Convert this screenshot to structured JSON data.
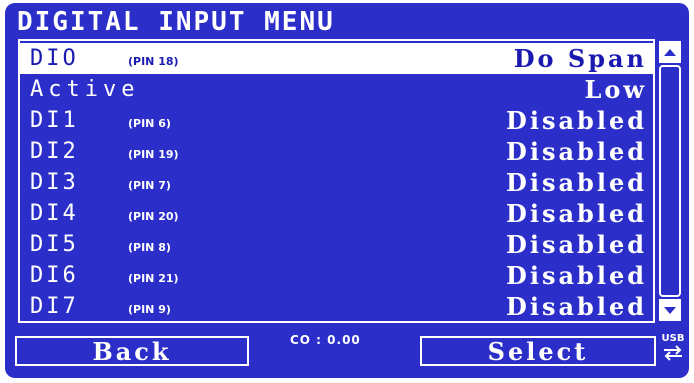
{
  "header": {
    "title": "DIGITAL INPUT MENU"
  },
  "rows": [
    {
      "name": "DIO",
      "pin": "(PIN 18)",
      "value": "Do Span",
      "selected": true
    },
    {
      "name": "Active",
      "pin": "",
      "value": "Low",
      "selected": false
    },
    {
      "name": "DI1",
      "pin": "(PIN 6)",
      "value": "Disabled",
      "selected": false
    },
    {
      "name": "DI2",
      "pin": "(PIN 19)",
      "value": "Disabled",
      "selected": false
    },
    {
      "name": "DI3",
      "pin": "(PIN 7)",
      "value": "Disabled",
      "selected": false
    },
    {
      "name": "DI4",
      "pin": "(PIN 20)",
      "value": "Disabled",
      "selected": false
    },
    {
      "name": "DI5",
      "pin": "(PIN 8)",
      "value": "Disabled",
      "selected": false
    },
    {
      "name": "DI6",
      "pin": "(PIN 21)",
      "value": "Disabled",
      "selected": false
    },
    {
      "name": "DI7",
      "pin": "(PIN 9)",
      "value": "Disabled",
      "selected": false
    }
  ],
  "scrollbar": {
    "up_icon": "arrow-up-icon",
    "down_icon": "arrow-down-icon"
  },
  "footer": {
    "back_label": "Back",
    "status": "CO : 0.00",
    "select_label": "Select",
    "usb_label": "USB",
    "usb_icon": "usb-transfer-icon"
  },
  "colors": {
    "background": "#2b2ec8",
    "foreground": "#ffffff",
    "selected_text": "#1a1ab0"
  }
}
